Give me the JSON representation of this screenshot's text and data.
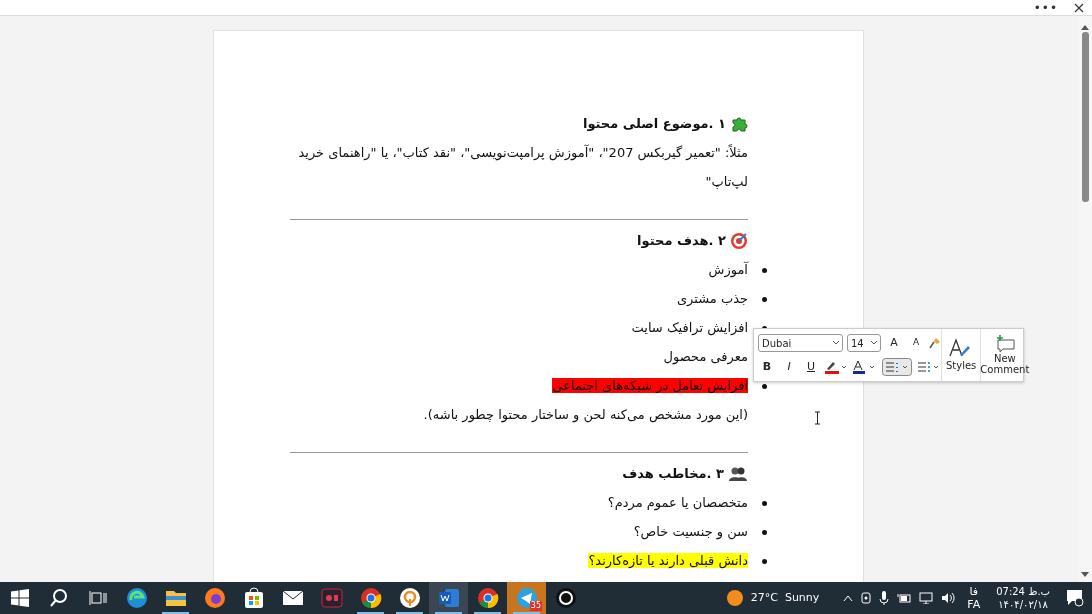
{
  "sections": [
    {
      "heading": "۱ .موضوع اصلی محتوا",
      "blocks": [
        {
          "kind": "paragraph",
          "text": "مثلاً: \"تعمیر گیربکس 207\"، \"آموزش پرامپت‌نویسی\"، \"نقد کتاب\"، یا \"راهنمای خرید لپ‌تاپ\""
        }
      ]
    },
    {
      "heading": "۲ .هدف محتوا",
      "blocks": [
        {
          "kind": "bullet",
          "text": "آموزش"
        },
        {
          "kind": "bullet",
          "text": "جذب مشتری"
        },
        {
          "kind": "bullet",
          "text": "افزایش ترافیک سایت"
        },
        {
          "kind": "bullet",
          "text": "معرفی محصول"
        },
        {
          "kind": "bullet",
          "text": "افزایش تعامل در شبکه‌های اجتماعی",
          "color": "#ff0000"
        },
        {
          "kind": "paragraph",
          "text": "(این مورد مشخص می‌کنه لحن و ساختار محتوا چطور باشه)."
        }
      ]
    },
    {
      "heading": "۳ .مخاطب هدف",
      "blocks": [
        {
          "kind": "bullet",
          "text": "متخصصان یا عموم مردم؟"
        },
        {
          "kind": "bullet",
          "text": "سن و جنسیت خاص؟"
        },
        {
          "kind": "bullet",
          "text": "دانش قبلی دارند یا تازه‌کارند؟",
          "color": "#ffff00"
        }
      ]
    }
  ],
  "top_bar": {
    "more": "•••"
  },
  "mini_toolbar": {
    "grow": "A",
    "shrink": "A",
    "bold": "B",
    "italic": "I",
    "underline": "U",
    "font": "Dubai",
    "size": "14",
    "styles_label": "Styles",
    "comment_label": "New Comment"
  },
  "taskbar": {
    "apps": [
      {
        "kind": "search",
        "running": false,
        "selected": false
      },
      {
        "kind": "taskview",
        "running": false,
        "selected": false
      },
      {
        "kind": "edge",
        "running": false,
        "selected": false
      },
      {
        "kind": "folder",
        "running": true,
        "selected": false
      },
      {
        "kind": "firefox",
        "running": false,
        "selected": false
      },
      {
        "kind": "store",
        "running": false,
        "selected": false
      },
      {
        "kind": "mail",
        "running": false,
        "selected": false
      },
      {
        "kind": "recorder",
        "running": false,
        "selected": false
      },
      {
        "kind": "chrome",
        "running": true,
        "selected": false
      },
      {
        "kind": "vpn",
        "running": true,
        "selected": false
      },
      {
        "kind": "word",
        "running": true,
        "selected": true
      },
      {
        "kind": "chrome",
        "running": true,
        "selected": false
      },
      {
        "kind": "telegram",
        "running": true,
        "selected": false,
        "flashing": true,
        "badge": "35"
      },
      {
        "kind": "ring",
        "running": false,
        "selected": false
      }
    ],
    "weather": "27°C  Sunny",
    "lang_top": "فا",
    "lang": "FA",
    "time": "07:24 ب.ظ",
    "date": "۱۴۰۴/۰۲/۱۸"
  }
}
